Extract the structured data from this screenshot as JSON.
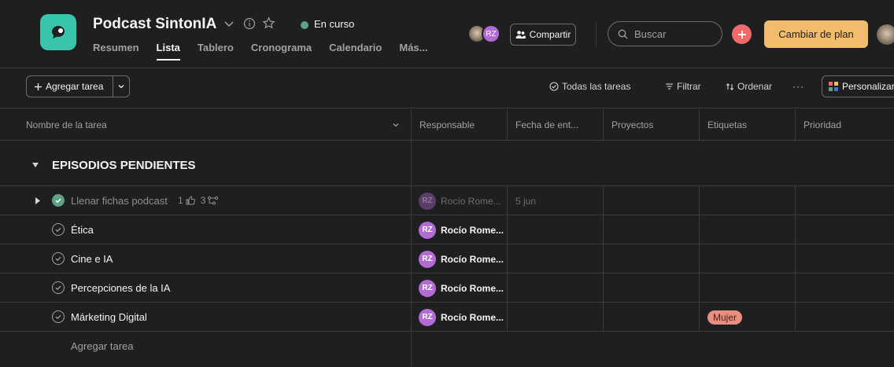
{
  "project": {
    "title": "Podcast SintonIA",
    "status": "En curso",
    "status_color": "#5da283",
    "icon": "chat-bubble-icon",
    "icon_color": "#37c5ab"
  },
  "tabs": [
    {
      "label": "Resumen",
      "active": false
    },
    {
      "label": "Lista",
      "active": true
    },
    {
      "label": "Tablero",
      "active": false
    },
    {
      "label": "Cronograma",
      "active": false
    },
    {
      "label": "Calendario",
      "active": false
    },
    {
      "label": "Más...",
      "active": false
    }
  ],
  "header": {
    "avatar_initials": "RZ",
    "share_label": "Compartir",
    "search_placeholder": "Buscar",
    "plan_label": "Cambiar de plan",
    "accent_color": "#f1bd6c"
  },
  "toolbar": {
    "add_task_label": "Agregar tarea",
    "all_tasks_label": "Todas las tareas",
    "filter_label": "Filtrar",
    "sort_label": "Ordenar",
    "more_label": "···",
    "customize_label": "Personalizar"
  },
  "columns": [
    "Nombre de la tarea",
    "Responsable",
    "Fecha de ent...",
    "Proyectos",
    "Etiquetas",
    "Prioridad"
  ],
  "section": {
    "title": "EPISODIOS PENDIENTES"
  },
  "tasks": [
    {
      "name": "Llenar fichas podcast",
      "completed": true,
      "likes": "1",
      "subtasks": "3",
      "assignee_initials": "RZ",
      "assignee": "Rocío Rome...",
      "due": "5 jun",
      "tag": ""
    },
    {
      "name": "Ética",
      "completed": false,
      "assignee_initials": "RZ",
      "assignee": "Rocío Rome...",
      "due": "",
      "tag": ""
    },
    {
      "name": "Cine e IA",
      "completed": false,
      "assignee_initials": "RZ",
      "assignee": "Rocío Rome...",
      "due": "",
      "tag": ""
    },
    {
      "name": "Percepciones de la IA",
      "completed": false,
      "assignee_initials": "RZ",
      "assignee": "Rocío Rome...",
      "due": "",
      "tag": ""
    },
    {
      "name": "Márketing Digital",
      "completed": false,
      "assignee_initials": "RZ",
      "assignee": "Rocío Rome...",
      "due": "",
      "tag": "Mujer"
    }
  ],
  "add_task_row_label": "Agregar tarea"
}
